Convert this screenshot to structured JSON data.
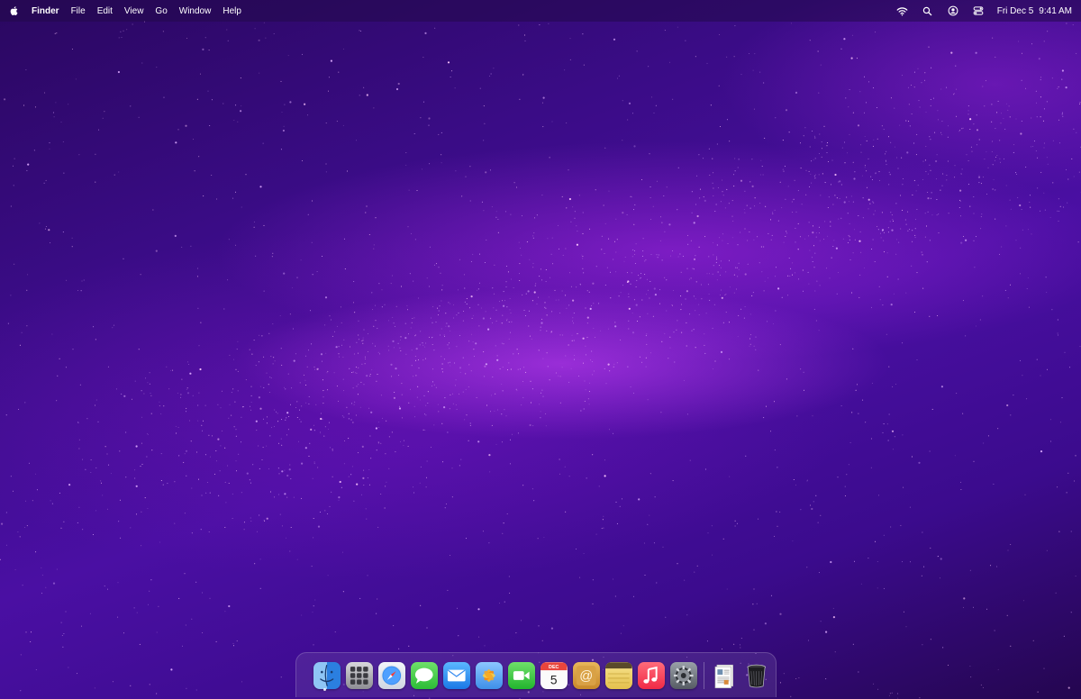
{
  "menubar": {
    "apple_icon": "apple-logo-icon",
    "app_name": "Finder",
    "menus": [
      "File",
      "Edit",
      "View",
      "Go",
      "Window",
      "Help"
    ],
    "status_icons": [
      "wifi-icon",
      "search-icon",
      "user-icon",
      "control-center-icon"
    ],
    "date": "Fri Dec 5",
    "time": "9:41 AM"
  },
  "dock": {
    "apps": [
      {
        "name": "Finder",
        "icon": "finder-icon",
        "running": true
      },
      {
        "name": "Launchpad",
        "icon": "launchpad-icon"
      },
      {
        "name": "Safari",
        "icon": "safari-icon"
      },
      {
        "name": "Messages",
        "icon": "messages-icon"
      },
      {
        "name": "Mail",
        "icon": "mail-icon"
      },
      {
        "name": "Photos",
        "icon": "photos-icon"
      },
      {
        "name": "FaceTime",
        "icon": "facetime-icon"
      },
      {
        "name": "Calendar",
        "icon": "calendar-icon",
        "month": "DEC",
        "day": "5"
      },
      {
        "name": "Contacts",
        "icon": "contacts-icon",
        "glyph": "@"
      },
      {
        "name": "Notes",
        "icon": "notes-icon"
      },
      {
        "name": "Music",
        "icon": "music-icon"
      },
      {
        "name": "System Settings",
        "icon": "gear-icon"
      }
    ],
    "extras": [
      {
        "name": "Documents",
        "icon": "document-icon"
      },
      {
        "name": "Trash",
        "icon": "trash-icon"
      }
    ]
  },
  "wallpaper": {
    "colors": [
      "#24064f",
      "#3a0c86",
      "#4a0fa3",
      "#b030e6"
    ]
  }
}
